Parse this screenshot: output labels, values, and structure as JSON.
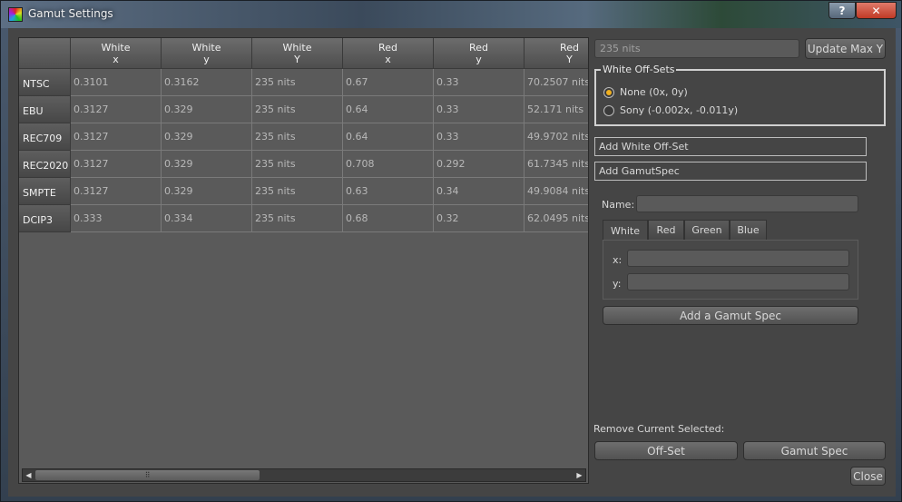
{
  "window": {
    "title": "Gamut Settings",
    "help_label": "?",
    "close_label": "✕"
  },
  "table": {
    "columns": [
      {
        "line1": "White",
        "line2": "x"
      },
      {
        "line1": "White",
        "line2": "y"
      },
      {
        "line1": "White",
        "line2": "Y"
      },
      {
        "line1": "Red",
        "line2": "x"
      },
      {
        "line1": "Red",
        "line2": "y"
      },
      {
        "line1": "Red",
        "line2": "Y"
      }
    ],
    "rows": [
      {
        "name": "NTSC",
        "cells": [
          "0.3101",
          "0.3162",
          "235 nits",
          "0.67",
          "0.33",
          "70.2507 nits"
        ]
      },
      {
        "name": "EBU",
        "cells": [
          "0.3127",
          "0.329",
          "235 nits",
          "0.64",
          "0.33",
          "52.171 nits"
        ]
      },
      {
        "name": "REC709",
        "cells": [
          "0.3127",
          "0.329",
          "235 nits",
          "0.64",
          "0.33",
          "49.9702 nits"
        ]
      },
      {
        "name": "REC2020",
        "cells": [
          "0.3127",
          "0.329",
          "235 nits",
          "0.708",
          "0.292",
          "61.7345 nits"
        ]
      },
      {
        "name": "SMPTE",
        "cells": [
          "0.3127",
          "0.329",
          "235 nits",
          "0.63",
          "0.34",
          "49.9084 nits"
        ]
      },
      {
        "name": "DCIP3",
        "cells": [
          "0.333",
          "0.334",
          "235 nits",
          "0.68",
          "0.32",
          "62.0495 nits"
        ]
      }
    ],
    "scroll_left": "◀",
    "scroll_right": "▶",
    "scroll_grip": "⠿"
  },
  "max_y": {
    "value": "235 nits",
    "button": "Update Max Y"
  },
  "white_offsets": {
    "title": "White Off-Sets",
    "options": [
      {
        "label": "None (0x, 0y)",
        "selected": true
      },
      {
        "label": "Sony (-0.002x, -0.011y)",
        "selected": false
      }
    ]
  },
  "add_white_offset_label": "Add White Off-Set",
  "add_gamut_spec_label": "Add GamutSpec",
  "spec_form": {
    "name_label": "Name:",
    "name_value": "",
    "tabs": [
      "White",
      "Red",
      "Green",
      "Blue"
    ],
    "active_tab": "White",
    "x_label": "x:",
    "y_label": "y:",
    "x_value": "",
    "y_value": "",
    "add_button": "Add a Gamut Spec"
  },
  "remove": {
    "label": "Remove Current Selected:",
    "offset_button": "Off-Set",
    "gamut_button": "Gamut Spec"
  },
  "close_button": "Close",
  "colors": {
    "accent": "#f0b020",
    "background": "#454545"
  }
}
